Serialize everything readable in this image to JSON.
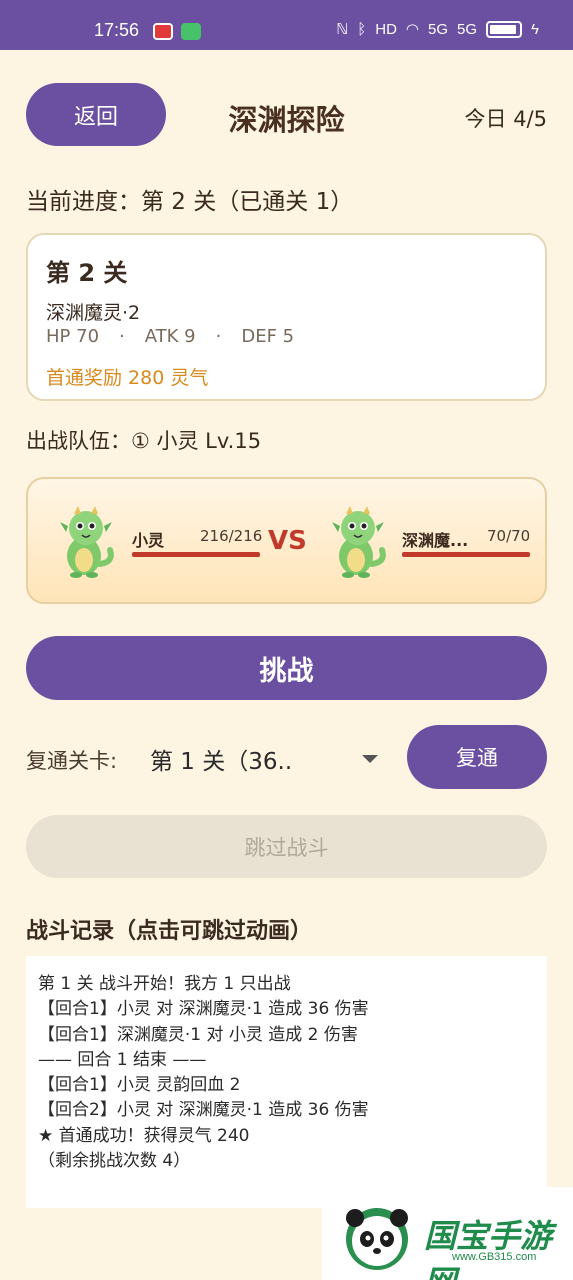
{
  "status_bar": {
    "time": "17:56",
    "icons": [
      "nfc-icon",
      "bluetooth-icon",
      "hd-icon",
      "wifi-icon",
      "signal-5g-icon",
      "signal-5g-icon",
      "battery-icon",
      "charging-icon"
    ],
    "hd": "HD",
    "net1": "5G",
    "net2": "5G"
  },
  "header": {
    "back_label": "返回",
    "title": "深渊探险",
    "today": "今日 4/5"
  },
  "progress": "当前进度：第 2 关（已通关 1）",
  "stage": {
    "title": "第 2 关",
    "enemy": "深渊魔灵·2",
    "hp": "HP 70",
    "sep1": "·",
    "atk": "ATK 9",
    "sep2": "·",
    "def": "DEF 5",
    "reward": "首通奖励  280 灵气"
  },
  "team": "出战队伍：① 小灵 Lv.15",
  "battle": {
    "vs": "VS",
    "player": {
      "name": "小灵",
      "hp_text": "216/216",
      "hp_fraction": 1.0
    },
    "enemy": {
      "name": "深渊魔...",
      "hp_text": "70/70",
      "hp_fraction": 1.0
    }
  },
  "challenge_label": "挑战",
  "replay": {
    "label": "复通关卡:",
    "selected": "第 1 关（36..",
    "button": "复通"
  },
  "skip_label": "跳过战斗",
  "log": {
    "title": "战斗记录（点击可跳过动画）",
    "lines": [
      "第 1 关 战斗开始！我方 1 只出战",
      "【回合1】小灵 对 深渊魔灵·1 造成 36 伤害",
      "【回合1】深渊魔灵·1 对 小灵 造成 2 伤害",
      "—— 回合 1 结束 ——",
      "【回合1】小灵 灵韵回血 2",
      "【回合2】小灵 对 深渊魔灵·1 造成 36 伤害",
      "★ 首通成功！获得灵气 240",
      "（剩余挑战次数 4）"
    ]
  },
  "watermark": {
    "text": "国宝手游网",
    "url": "www.GB315.com"
  },
  "colors": {
    "primary": "#6b4fa0",
    "background": "#fdf5e2",
    "reward": "#d98a1e",
    "hp_bar": "#c0392b",
    "vs": "#c0392b"
  }
}
